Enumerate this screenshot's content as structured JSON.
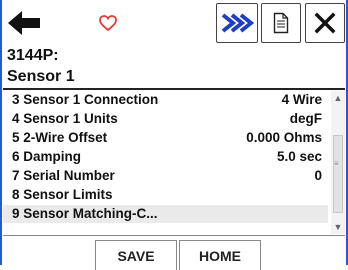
{
  "header": {
    "tag": "3144P:",
    "title": "Sensor 1"
  },
  "toolbar": {
    "back_icon": "back-arrow-icon",
    "favorite_icon": "heart-icon",
    "fast_key_icon": "fast-forward-icon",
    "document_icon": "document-icon",
    "close_icon": "close-icon"
  },
  "list": {
    "rows": [
      {
        "label": "3 Sensor 1 Connection",
        "value": "4 Wire"
      },
      {
        "label": "4 Sensor 1 Units",
        "value": "degF"
      },
      {
        "label": "5 2-Wire Offset",
        "value": "0.000 Ohms"
      },
      {
        "label": "6 Damping",
        "value": "5.0 sec"
      },
      {
        "label": "7 Serial Number",
        "value": "0"
      },
      {
        "label": "8 Sensor Limits",
        "value": ""
      },
      {
        "label": "9 Sensor Matching-C...",
        "value": ""
      }
    ]
  },
  "buttons": {
    "save": "SAVE",
    "home": "HOME"
  },
  "colors": {
    "accent_blue": "#2a57d6",
    "heart_red": "#e0403a"
  }
}
